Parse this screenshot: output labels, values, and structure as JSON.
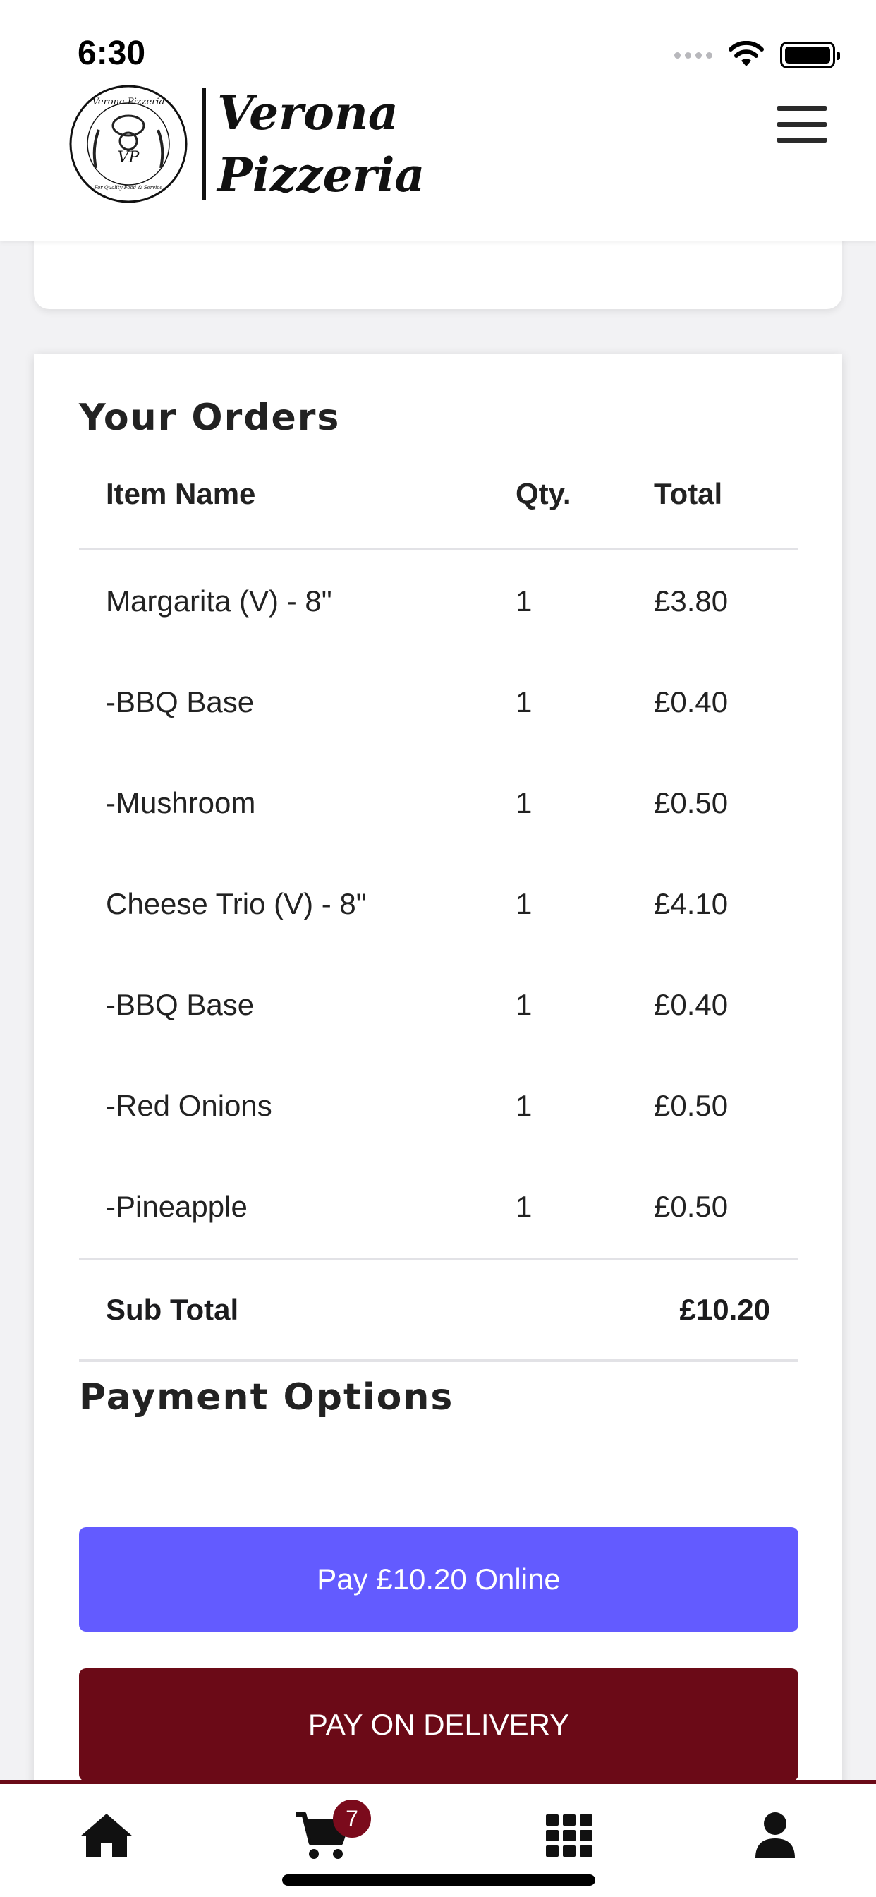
{
  "status_bar": {
    "time": "6:30"
  },
  "header": {
    "logo": {
      "name_line1": "Verona",
      "name_line2": "Pizzeria",
      "seal_text_top": "Verona Pizzeria",
      "seal_initials": "VP",
      "seal_text_bottom": "For Quality Food & Service"
    },
    "menu_icon": "hamburger-icon"
  },
  "orders": {
    "title": "Your Orders",
    "columns": [
      "Item Name",
      "Qty.",
      "Total"
    ],
    "rows": [
      {
        "item": "Margarita (V) - 8\"",
        "qty": "1",
        "total": "£3.80"
      },
      {
        "item": "-BBQ Base",
        "qty": "1",
        "total": "£0.40"
      },
      {
        "item": "-Mushroom",
        "qty": "1",
        "total": "£0.50"
      },
      {
        "item": "Cheese Trio (V) - 8\"",
        "qty": "1",
        "total": "£4.10"
      },
      {
        "item": "-BBQ Base",
        "qty": "1",
        "total": "£0.40"
      },
      {
        "item": "-Red Onions",
        "qty": "1",
        "total": "£0.50"
      },
      {
        "item": "-Pineapple",
        "qty": "1",
        "total": "£0.50"
      }
    ],
    "subtotal_label": "Sub Total",
    "subtotal_value": "£10.20"
  },
  "payment": {
    "title": "Payment Options",
    "online_label": "Pay £10.20 Online",
    "delivery_label": "PAY ON DELIVERY"
  },
  "bottom_nav": {
    "items": [
      "home-icon",
      "cart-icon",
      "grid-icon",
      "user-icon"
    ],
    "cart_count": "7"
  },
  "colors": {
    "brand": "#6b0a17",
    "online_button": "#635bff"
  }
}
